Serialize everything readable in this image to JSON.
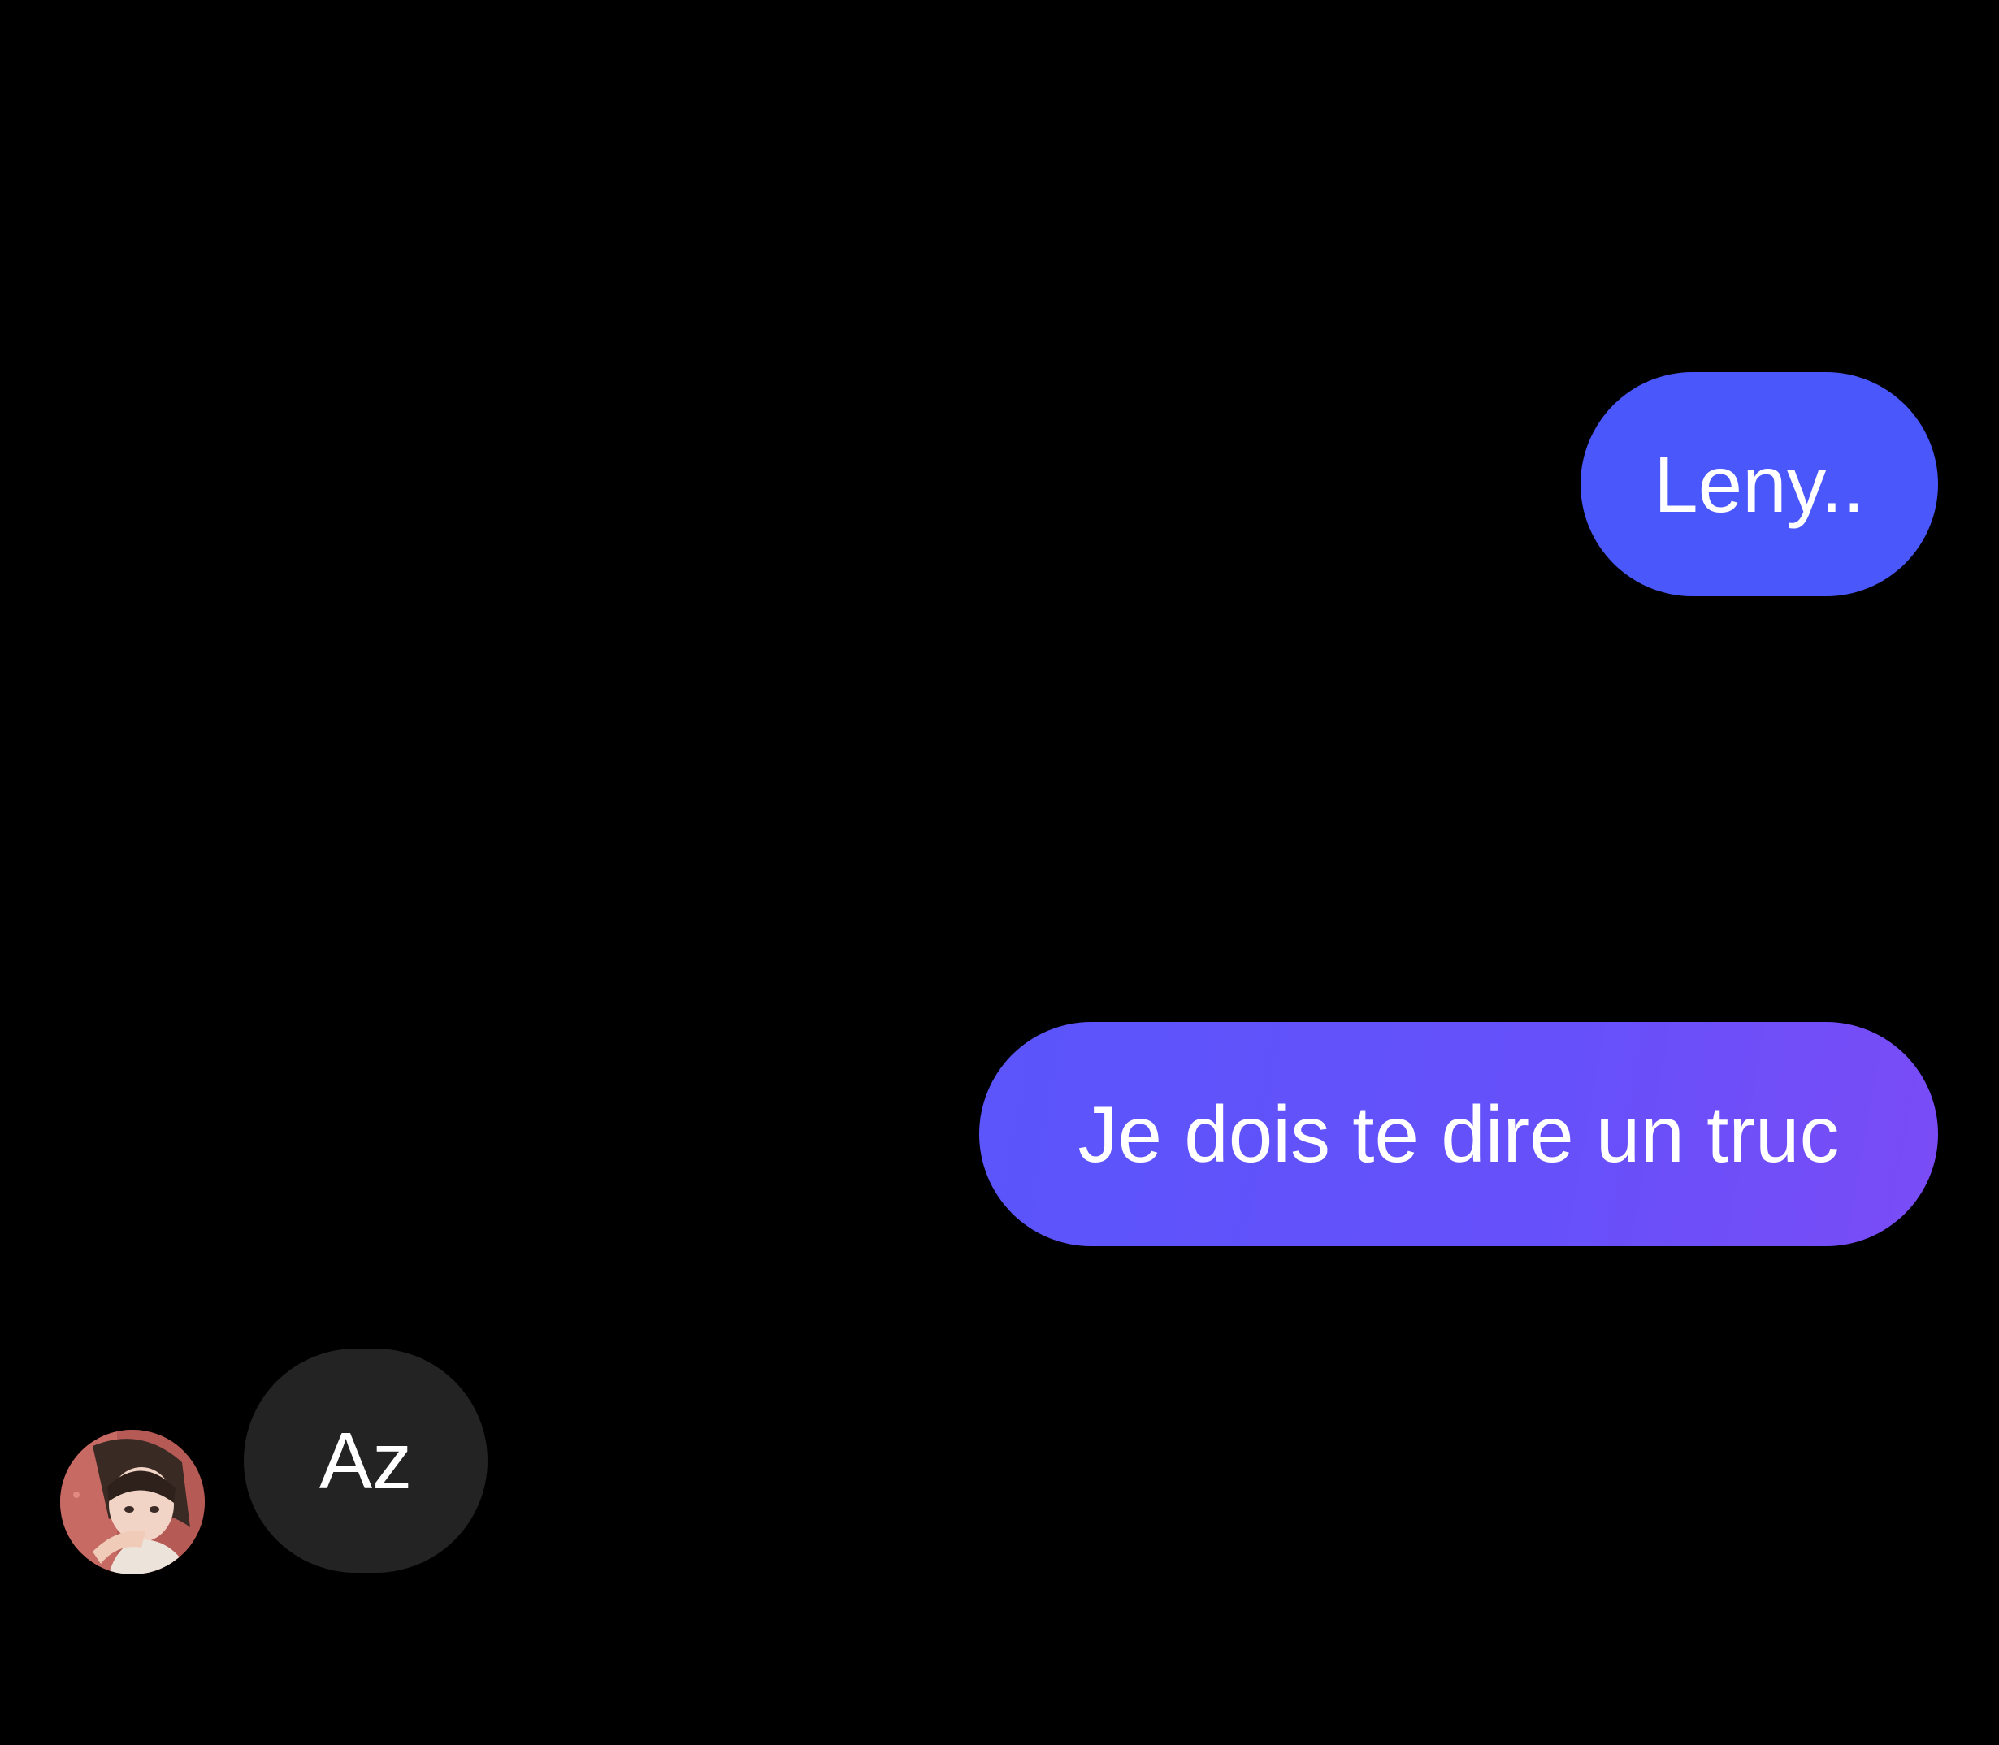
{
  "conversation": {
    "messages": [
      {
        "sender": "me",
        "text": "Leny.."
      },
      {
        "sender": "me",
        "text": "Je dois te dire un truc"
      },
      {
        "sender": "contact",
        "text": "Az"
      }
    ],
    "contact": {
      "avatar": "anime-girl-avatar"
    }
  },
  "colors": {
    "background": "#000000",
    "outgoing_bubble": "#4A57FA",
    "outgoing_bubble_gradient_end": "#7A4CF6",
    "incoming_bubble": "#232323",
    "text": "#ffffff"
  }
}
